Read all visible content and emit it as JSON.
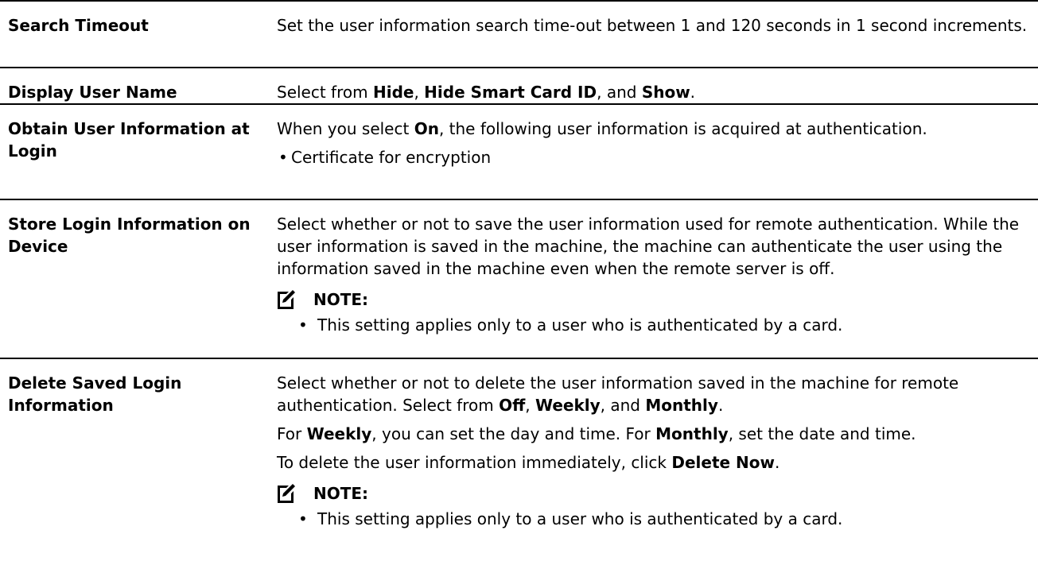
{
  "rows": [
    {
      "label": "Search Timeout",
      "desc": "Set the user information search time-out between 1 and 120 seconds in 1 second increments."
    },
    {
      "label": "Display User Name",
      "desc_pre": "Select from ",
      "opt1": "Hide",
      "sep1": ", ",
      "opt2": "Hide Smart Card ID",
      "sep2": ", and ",
      "opt3": "Show",
      "desc_post": "."
    },
    {
      "label": "Obtain User Information at Login",
      "desc_pre": "When you select ",
      "opt1": "On",
      "desc_post": ", the following user information is acquired at authentication.",
      "bullet": "Certificate for encryption"
    },
    {
      "label": "Store Login Information on Device",
      "desc": "Select whether or not to save the user information used for remote authentication. While the user information is saved in the machine, the machine can authenticate the user using the information saved in the machine even when the remote server is off.",
      "note_label": "NOTE:",
      "note_bullet": "This setting applies only to a user who is authenticated by a card."
    },
    {
      "label": "Delete Saved Login Information",
      "p1_pre": "Select whether or not to delete the user information saved in the machine for remote authentication. Select from ",
      "p1_opt1": "Off",
      "p1_sep1": ", ",
      "p1_opt2": "Weekly",
      "p1_sep2": ", and ",
      "p1_opt3": "Monthly",
      "p1_post": ".",
      "p2_pre": "For ",
      "p2_opt1": "Weekly",
      "p2_mid": ", you can set the day and time. For ",
      "p2_opt2": "Monthly",
      "p2_post": ", set the date and time.",
      "p3_pre": "To delete the user information immediately, click ",
      "p3_opt": "Delete Now",
      "p3_post": ".",
      "note_label": "NOTE:",
      "note_bullet": "This setting applies only to a user who is authenticated by a card."
    }
  ],
  "icons": {
    "note": "pencil-note-icon",
    "bullet": "•"
  }
}
